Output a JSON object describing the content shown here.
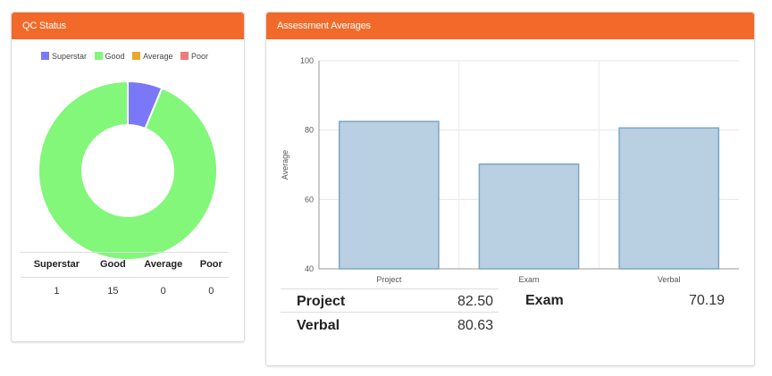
{
  "qc_panel": {
    "title": "QC Status",
    "legend": [
      {
        "label": "Superstar",
        "color": "#7b78f7"
      },
      {
        "label": "Good",
        "color": "#82f77a"
      },
      {
        "label": "Average",
        "color": "#e8a92a"
      },
      {
        "label": "Poor",
        "color": "#ef7b7b"
      }
    ],
    "table": {
      "headers": [
        "Superstar",
        "Good",
        "Average",
        "Poor"
      ],
      "values": [
        "1",
        "15",
        "0",
        "0"
      ]
    }
  },
  "assessment_panel": {
    "title": "Assessment Averages",
    "rows": [
      {
        "label": "Project",
        "value": "82.50"
      },
      {
        "label": "Exam",
        "value": "70.19"
      },
      {
        "label": "Verbal",
        "value": "80.63"
      }
    ]
  },
  "chart_data": [
    {
      "type": "pie",
      "donut": true,
      "categories": [
        "Superstar",
        "Good",
        "Average",
        "Poor"
      ],
      "values": [
        1,
        15,
        0,
        0
      ],
      "colors": [
        "#7b78f7",
        "#82f77a",
        "#e8a92a",
        "#ef7b7b"
      ],
      "legend": "top"
    },
    {
      "type": "bar",
      "categories": [
        "Project",
        "Exam",
        "Verbal"
      ],
      "values": [
        82.5,
        70.19,
        80.63
      ],
      "ylabel": "Average",
      "ylim": [
        40,
        100
      ],
      "yticks": [
        40,
        60,
        80,
        100
      ],
      "grid": true,
      "bar_fill": "#b8d0e2",
      "bar_stroke": "#7da7c4"
    }
  ]
}
